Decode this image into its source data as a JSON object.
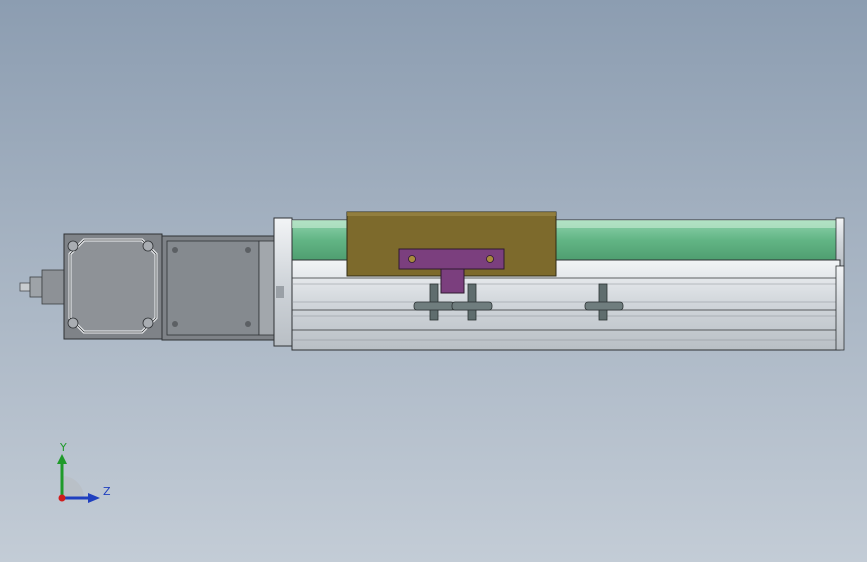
{
  "viewport": {
    "background_top": "#8c9db1",
    "background_bottom": "#c3ccd6"
  },
  "model": {
    "motor_color": "#8a8d91",
    "carriage_color": "#7d6a2c",
    "plate_color": "#7b3f7e",
    "guide_color": "#66b98a",
    "rail_color": "#d3d7dc",
    "sensor_color": "#5f6d6e"
  },
  "triad": {
    "y_label": "Y",
    "z_label": "Z",
    "y_color": "#1f9a2a",
    "z_color": "#1f3fbf",
    "origin_color": "#d01c1c",
    "y_icon": "y-axis-arrow",
    "z_icon": "z-axis-arrow"
  }
}
